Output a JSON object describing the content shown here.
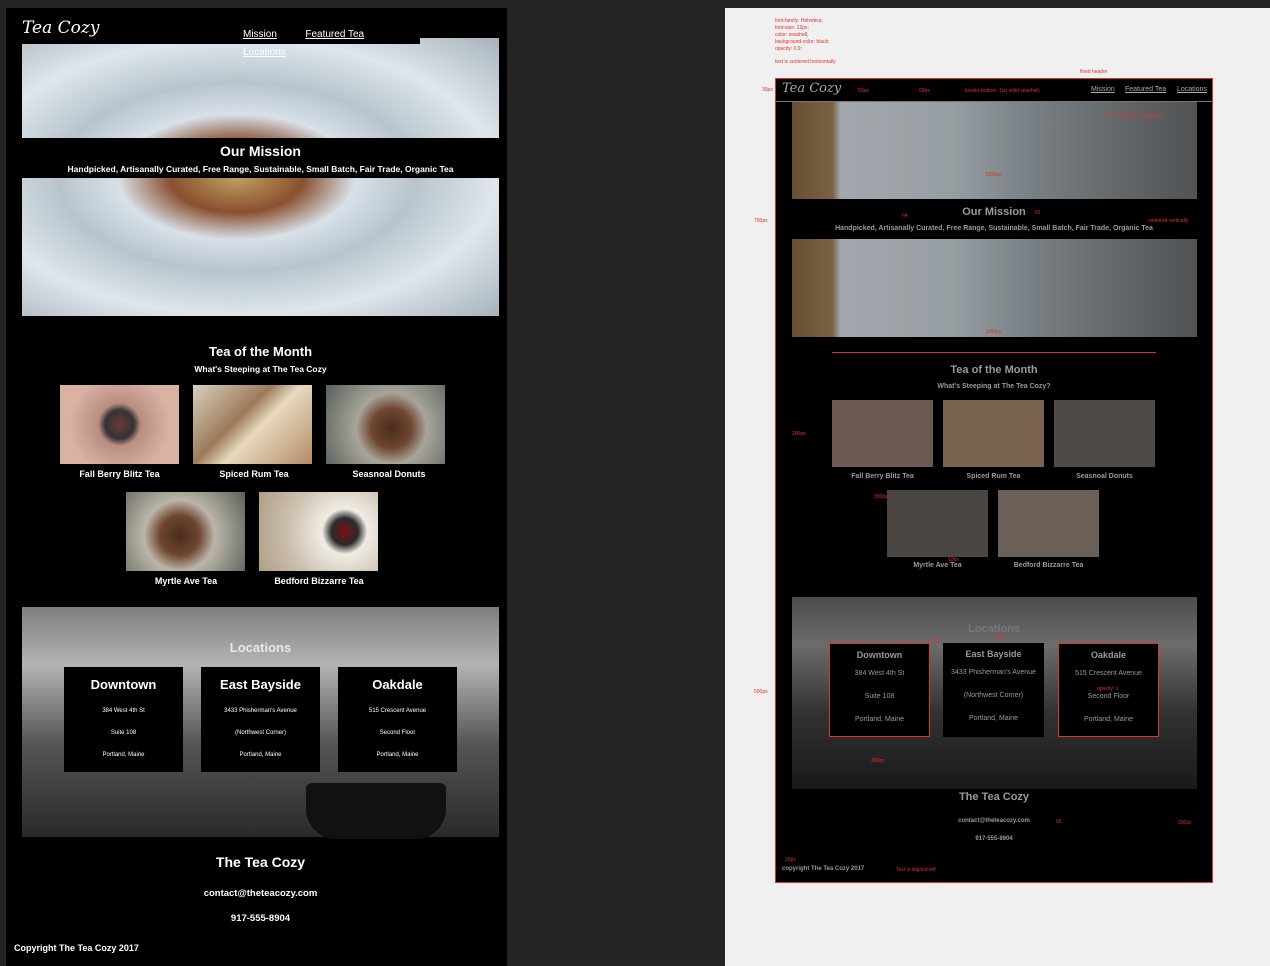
{
  "site": {
    "logo": "Tea Cozy",
    "nav": [
      "Mission",
      "Featured Tea",
      "Locations"
    ],
    "mission": {
      "heading": "Our Mission",
      "tagline": "Handpicked, Artisanally Curated, Free Range, Sustainable, Small Batch, Fair Trade, Organic Tea"
    },
    "teas": {
      "heading": "Tea of the Month",
      "subheading": "What's Steeping at The Tea Cozy",
      "items": [
        "Fall Berry Blitz Tea",
        "Spiced Rum Tea",
        "Seasnoal Donuts",
        "Myrtle Ave Tea",
        "Bedford Bizzarre Tea"
      ]
    },
    "locations": {
      "heading": "Locations",
      "items": [
        {
          "name": "Downtown",
          "line1": "384 West 4th St",
          "line2": "Suite 108",
          "line3": "Portland, Maine"
        },
        {
          "name": "East Bayside",
          "line1": "3433 Phisherman's Avenue",
          "line2": "(Northwest Corner)",
          "line3": "Portland, Maine"
        },
        {
          "name": "Oakdale",
          "line1": "515 Crescent Avenue",
          "line2": "Second Floor",
          "line3": "Portland, Maine"
        }
      ]
    },
    "footer": {
      "title": "The Tea Cozy",
      "email": "contact@theteacozy.com",
      "phone": "917-555-8904",
      "copyright": "Copyright The Tea Cozy 2017"
    }
  },
  "mockup": {
    "spec_lines": [
      "font-family: Helvetica;",
      "font-size: 22px;",
      "color: seashell;",
      "background-color: black;",
      "opacity: 0.9;"
    ],
    "spec_note": "text is centered horizontally",
    "fixed_header": "fixed header",
    "dim_30": "30px",
    "dim_50": "50px",
    "dim_69": "69px",
    "border_note": "border-bottom: 1px solid seashell;",
    "underline_note": "text-decoration: underline;",
    "dim_1200": "1200px",
    "h4": "h4",
    "h2": "h2",
    "centered_vertically": "centered vertically",
    "dim_700": "700px",
    "dim_1000": "1000px",
    "dim_200": "200px",
    "dim_300": "300px",
    "dim_10": "10px",
    "dim_500": "500px",
    "dim_30b": "30px",
    "dim_15": "15px",
    "h3": "h3",
    "opacity_1": "opacity: 1",
    "dim_300b": "300px",
    "h5": "h5",
    "dim_200b": "200px",
    "dim_20": "20px",
    "text_left": "Text is aligned left",
    "teas_sub": "What's Steeping at The Tea Cozy?",
    "copyright": "copyright The Tea Cozy 2017",
    "oakdale_line2": "Second Floor"
  }
}
